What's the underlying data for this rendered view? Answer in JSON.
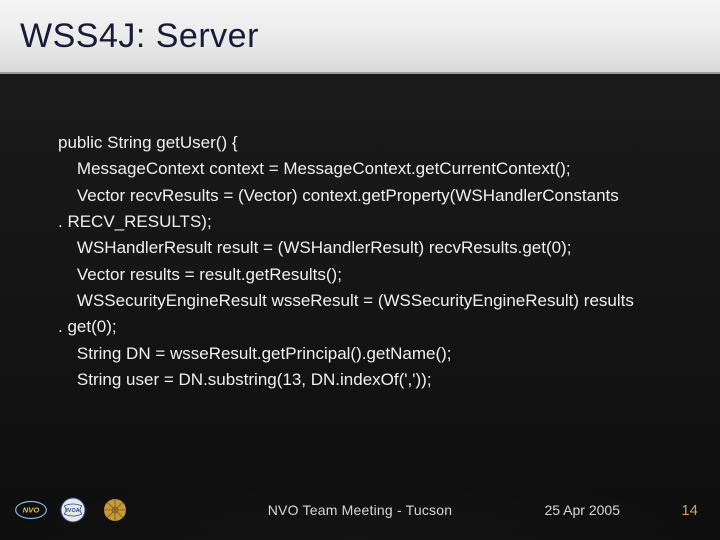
{
  "slide": {
    "title": "WSS4J: Server",
    "code_lines": [
      "public String getUser() {",
      "    MessageContext context = MessageContext.getCurrentContext();",
      "    Vector recvResults = (Vector) context.getProperty(WSHandlerConstants",
      ". RECV_RESULTS);",
      "    WSHandlerResult result = (WSHandlerResult) recvResults.get(0);",
      "    Vector results = result.getResults();",
      "    WSSecurityEngineResult wsseResult = (WSSecurityEngineResult) results",
      ". get(0);",
      "    String DN = wsseResult.getPrincipal().getName();",
      "    String user = DN.substring(13, DN.indexOf(','));"
    ]
  },
  "footer": {
    "center": "NVO Team Meeting - Tucson",
    "date": "25 Apr 2005",
    "page": "14"
  },
  "logos": {
    "nvo": "NVO",
    "ivoa": "IVOA",
    "aura": "AURA"
  }
}
